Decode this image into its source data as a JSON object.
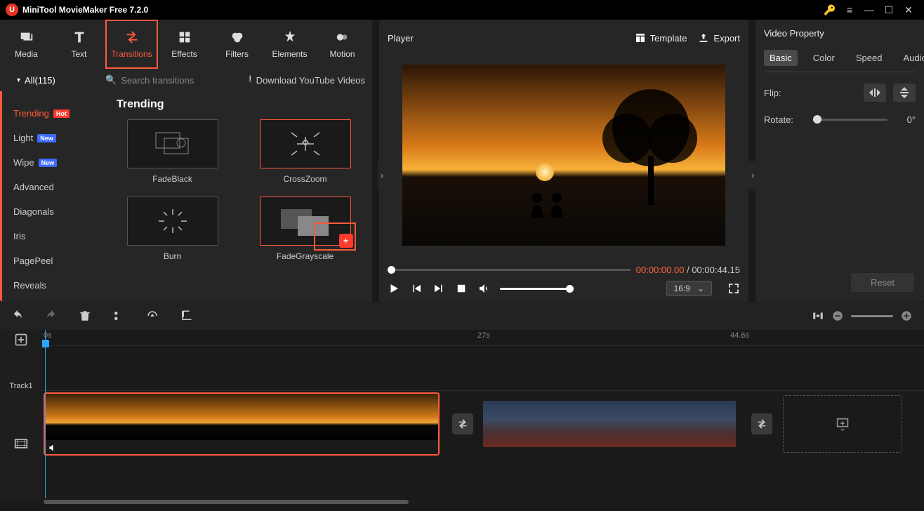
{
  "app": {
    "title": "MiniTool MovieMaker Free 7.2.0"
  },
  "libtabs": {
    "media": "Media",
    "text": "Text",
    "transitions": "Transitions",
    "effects": "Effects",
    "filters": "Filters",
    "elements": "Elements",
    "motion": "Motion"
  },
  "library": {
    "all_label": "All(115)",
    "search_placeholder": "Search transitions",
    "download_label": "Download YouTube Videos",
    "section_title": "Trending",
    "categories": [
      {
        "label": "Trending",
        "badge": "Hot",
        "active": true
      },
      {
        "label": "Light",
        "badge": "New"
      },
      {
        "label": "Wipe",
        "badge": "New"
      },
      {
        "label": "Advanced"
      },
      {
        "label": "Diagonals"
      },
      {
        "label": "Iris"
      },
      {
        "label": "PagePeel"
      },
      {
        "label": "Reveals"
      }
    ],
    "items": [
      {
        "name": "FadeBlack"
      },
      {
        "name": "CrossZoom",
        "selected": true
      },
      {
        "name": "Burn"
      },
      {
        "name": "FadeGrayscale",
        "selected": true,
        "add_visible": true
      }
    ]
  },
  "player": {
    "label": "Player",
    "template_label": "Template",
    "export_label": "Export",
    "time_current": "00:00:00.00",
    "time_total": "00:00:44.15",
    "ratio": "16:9"
  },
  "property": {
    "title": "Video Property",
    "tabs": {
      "basic": "Basic",
      "color": "Color",
      "speed": "Speed",
      "audio": "Audio"
    },
    "flip_label": "Flip:",
    "rotate_label": "Rotate:",
    "rotate_value": "0°",
    "reset_label": "Reset"
  },
  "timeline": {
    "ticks": {
      "t0": "0s",
      "t1": "27s",
      "t2": "44.6s"
    },
    "track_label": "Track1"
  }
}
